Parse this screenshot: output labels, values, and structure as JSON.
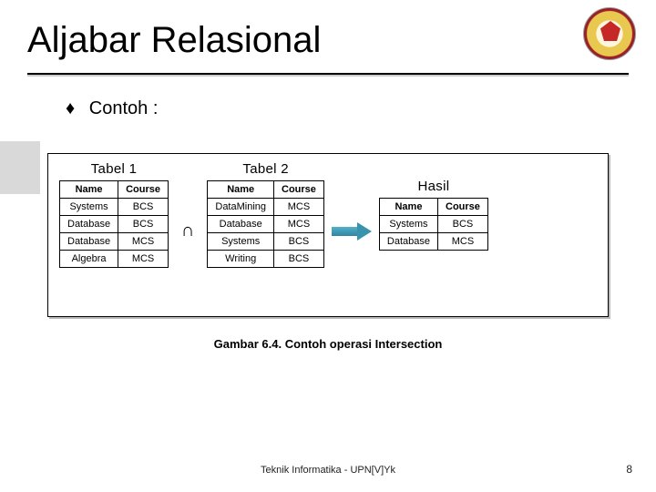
{
  "slide_title": "Aljabar Relasional",
  "bullet": {
    "marker": "♦",
    "text": "Contoh :"
  },
  "caption": "Gambar 6.4. Contoh operasi Intersection",
  "footer": "Teknik Informatika - UPN[V]Yk",
  "page_number": "8",
  "operator_symbol": "∩",
  "tables": {
    "t1": {
      "title": "Tabel 1",
      "headers": {
        "c1": "Name",
        "c2": "Course"
      },
      "rows": [
        {
          "c1": "Systems",
          "c2": "BCS"
        },
        {
          "c1": "Database",
          "c2": "BCS"
        },
        {
          "c1": "Database",
          "c2": "MCS"
        },
        {
          "c1": "Algebra",
          "c2": "MCS"
        }
      ]
    },
    "t2": {
      "title": "Tabel 2",
      "headers": {
        "c1": "Name",
        "c2": "Course"
      },
      "rows": [
        {
          "c1": "DataMining",
          "c2": "MCS"
        },
        {
          "c1": "Database",
          "c2": "MCS"
        },
        {
          "c1": "Systems",
          "c2": "BCS"
        },
        {
          "c1": "Writing",
          "c2": "BCS"
        }
      ]
    },
    "result": {
      "title": "Hasil",
      "headers": {
        "c1": "Name",
        "c2": "Course"
      },
      "rows": [
        {
          "c1": "Systems",
          "c2": "BCS"
        },
        {
          "c1": "Database",
          "c2": "MCS"
        }
      ]
    }
  }
}
